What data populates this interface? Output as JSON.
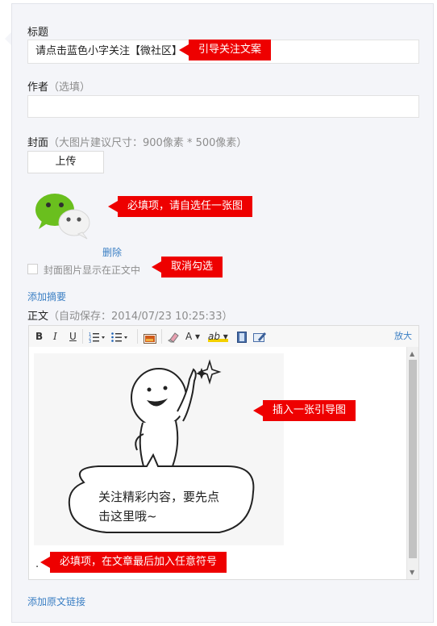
{
  "title_field": {
    "label": "标题",
    "value": "请点击蓝色小字关注【微社区】"
  },
  "author_field": {
    "label": "作者",
    "hint": "（选填）",
    "value": ""
  },
  "cover": {
    "label": "封面",
    "hint": "（大图片建议尺寸：900像素 * 500像素）",
    "upload_label": "上传",
    "delete_label": "删除",
    "show_in_body_label": "封面图片显示在正文中",
    "show_in_body_checked": false
  },
  "add_summary_label": "添加摘要",
  "body_field": {
    "label": "正文",
    "hint": "（自动保存：2014/07/23 10:25:33）"
  },
  "toolbar": {
    "bold": "B",
    "italic": "I",
    "underline": "U",
    "font_color": "A",
    "highlight": "ab",
    "expand_label": "放大"
  },
  "editor_content": {
    "image_text": "关注精彩内容，要先点\n击这里哦~",
    "trailing_symbol": "."
  },
  "add_source_link_label": "添加原文链接",
  "callouts": {
    "guide_text": "引导关注文案",
    "cover_required": "必填项，请自选任一张图",
    "uncheck": "取消勾选",
    "insert_guide_image": "插入一张引导图",
    "symbol_required": "必填项，在文章最后加入任意符号"
  },
  "colors": {
    "callout_red": "#ee0000",
    "link_blue": "#3b7fc4",
    "wechat_green": "#6abf1e"
  }
}
